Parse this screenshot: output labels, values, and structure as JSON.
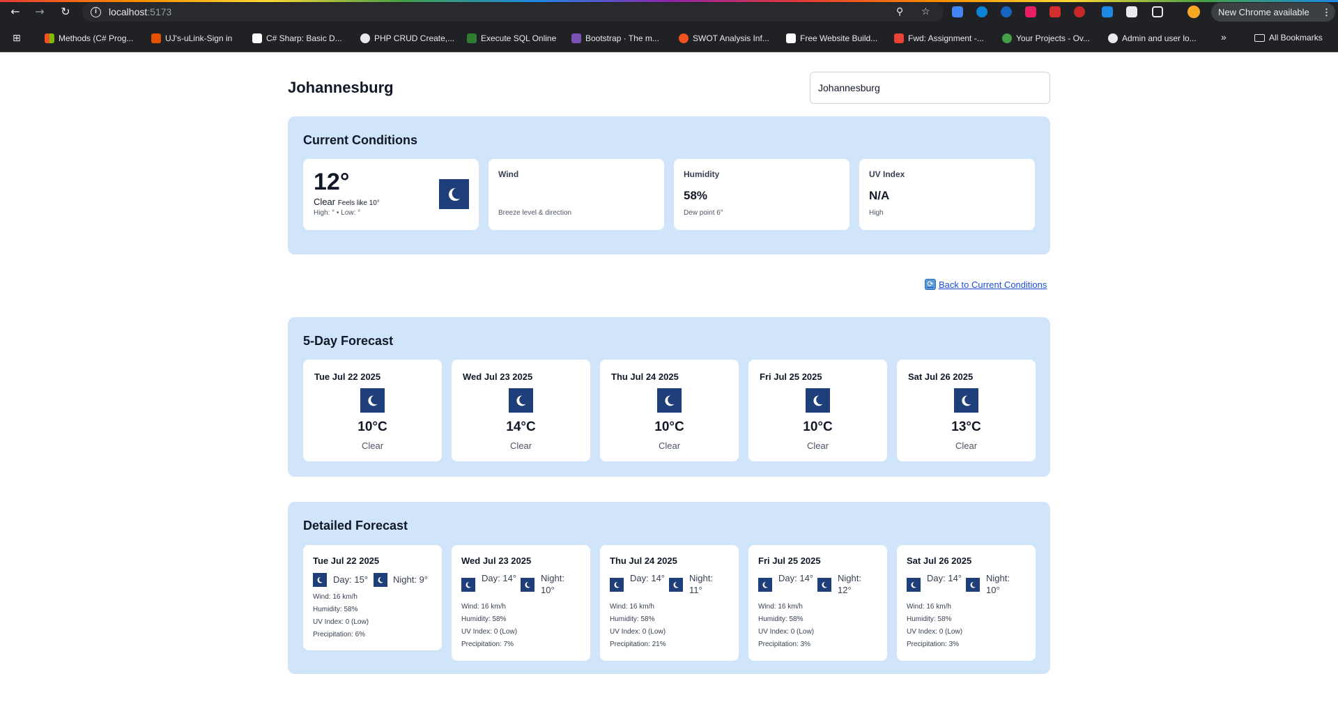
{
  "browser": {
    "url_host": "localhost",
    "url_port": ":5173",
    "new_chrome": "New Chrome available",
    "bookmarks": [
      "Methods (C# Prog...",
      "UJ's-uLink-Sign in",
      "C# Sharp: Basic D...",
      "PHP CRUD Create,...",
      "Execute SQL Online",
      "Bootstrap · The m...",
      "SWOT Analysis Inf...",
      "Free Website Build...",
      "Fwd: Assignment -...",
      "Your Projects - Ov...",
      "Admin and user lo..."
    ],
    "more": "»",
    "all_bookmarks": "All Bookmarks"
  },
  "page": {
    "city": "Johannesburg",
    "search_value": "Johannesburg",
    "back_link": "Back to Current Conditions"
  },
  "current": {
    "title": "Current Conditions",
    "temp": "12°",
    "condition": "Clear",
    "feels": "Feels like 10°",
    "hilo": "High: ° • Low: °",
    "wind": {
      "label": "Wind",
      "value": "",
      "sub": "Breeze level & direction"
    },
    "humidity": {
      "label": "Humidity",
      "value": "58%",
      "sub": "Dew point 6°"
    },
    "uv": {
      "label": "UV Index",
      "value": "N/A",
      "sub": "High"
    }
  },
  "forecast5": {
    "title": "5-Day Forecast",
    "days": [
      {
        "date": "Tue Jul 22 2025",
        "temp": "10°C",
        "cond": "Clear"
      },
      {
        "date": "Wed Jul 23 2025",
        "temp": "14°C",
        "cond": "Clear"
      },
      {
        "date": "Thu Jul 24 2025",
        "temp": "10°C",
        "cond": "Clear"
      },
      {
        "date": "Fri Jul 25 2025",
        "temp": "10°C",
        "cond": "Clear"
      },
      {
        "date": "Sat Jul 26 2025",
        "temp": "13°C",
        "cond": "Clear"
      }
    ]
  },
  "detailed": {
    "title": "Detailed Forecast",
    "days": [
      {
        "date": "Tue Jul 22 2025",
        "day": "Day: 15°",
        "night": "Night: 9°",
        "wind": "Wind: 16 km/h",
        "humidity": "Humidity: 58%",
        "uv": "UV Index: 0 (Low)",
        "precip": "Precipitation: 6%"
      },
      {
        "date": "Wed Jul 23 2025",
        "day": "Day: 14°",
        "night": "Night: 10°",
        "wind": "Wind: 16 km/h",
        "humidity": "Humidity: 58%",
        "uv": "UV Index: 0 (Low)",
        "precip": "Precipitation: 7%"
      },
      {
        "date": "Thu Jul 24 2025",
        "day": "Day: 14°",
        "night": "Night: 11°",
        "wind": "Wind: 16 km/h",
        "humidity": "Humidity: 58%",
        "uv": "UV Index: 0 (Low)",
        "precip": "Precipitation: 21%"
      },
      {
        "date": "Fri Jul 25 2025",
        "day": "Day: 14°",
        "night": "Night: 12°",
        "wind": "Wind: 16 km/h",
        "humidity": "Humidity: 58%",
        "uv": "UV Index: 0 (Low)",
        "precip": "Precipitation: 3%"
      },
      {
        "date": "Sat Jul 26 2025",
        "day": "Day: 14°",
        "night": "Night: 10°",
        "wind": "Wind: 16 km/h",
        "humidity": "Humidity: 58%",
        "uv": "UV Index: 0 (Low)",
        "precip": "Precipitation: 3%"
      }
    ]
  },
  "colors": {
    "panel": "#d0e4fa",
    "icon_bg": "#1f3f7a",
    "link": "#1d4ed8"
  }
}
